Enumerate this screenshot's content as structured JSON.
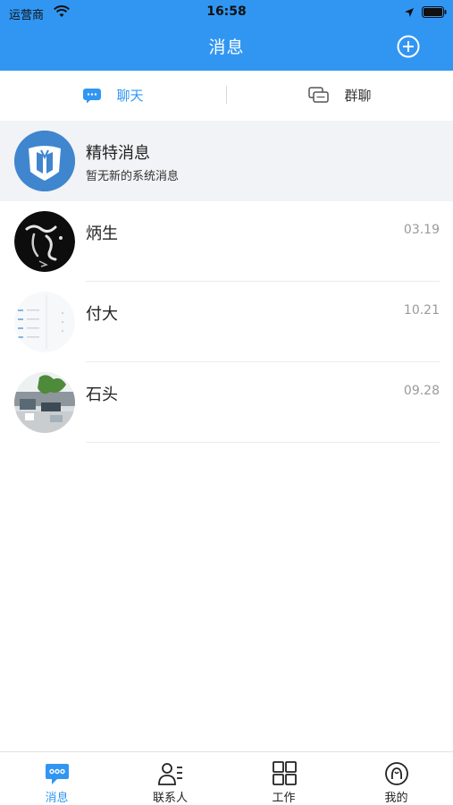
{
  "status_bar": {
    "carrier": "运营商",
    "time": "16:58"
  },
  "header": {
    "title": "消息",
    "add_icon": "plus-circle-icon"
  },
  "segments": [
    {
      "label": "聊天",
      "icon": "chat-bubble-icon",
      "active": true
    },
    {
      "label": "群聊",
      "icon": "group-chat-icon",
      "active": false
    }
  ],
  "system_message": {
    "name": "精特消息",
    "subtitle": "暂无新的系统消息"
  },
  "chats": [
    {
      "name": "炳生",
      "date": "03.19"
    },
    {
      "name": "付大",
      "date": "10.21"
    },
    {
      "name": "石头",
      "date": "09.28"
    }
  ],
  "bottom_nav": [
    {
      "label": "消息",
      "icon": "message-icon",
      "active": true
    },
    {
      "label": "联系人",
      "icon": "contacts-icon",
      "active": false
    },
    {
      "label": "工作",
      "icon": "grid-icon",
      "active": false
    },
    {
      "label": "我的",
      "icon": "profile-icon",
      "active": false
    }
  ],
  "colors": {
    "accent": "#3196f2",
    "row_highlight": "#f2f3f6",
    "date_text": "#9a9a9a"
  }
}
